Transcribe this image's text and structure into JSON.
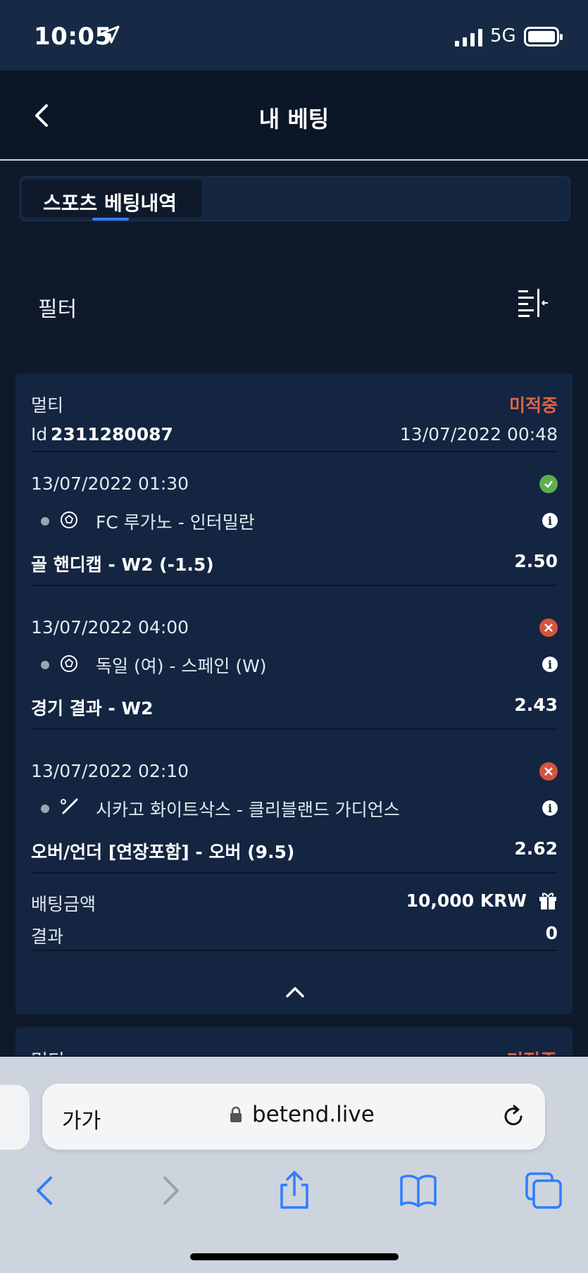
{
  "status_bar": {
    "time": "10:05",
    "network": "5G"
  },
  "header": {
    "title": "내 베팅"
  },
  "tabs": [
    {
      "label": "스포츠 베팅내역",
      "active": true
    }
  ],
  "filter": {
    "label": "필터"
  },
  "bet": {
    "type": "멀티",
    "status": "미적중",
    "id_label": "Id",
    "id_value": "2311280087",
    "placed_at": "13/07/2022 00:48",
    "selections": [
      {
        "datetime": "13/07/2022 01:30",
        "result": "won",
        "sport": "soccer",
        "event": "FC 루가노 - 인터밀란",
        "market": "골 핸디캡 - W2 (-1.5)",
        "odds": "2.50"
      },
      {
        "datetime": "13/07/2022 04:00",
        "result": "lost",
        "sport": "soccer",
        "event": "독일 (여) - 스페인 (W)",
        "market": "경기 결과 - W2",
        "odds": "2.43"
      },
      {
        "datetime": "13/07/2022 02:10",
        "result": "lost",
        "sport": "baseball",
        "event": "시카고 화이트삭스 - 클리블랜드 가디언스",
        "market": "오버/언더 [연장포함] - 오버 (9.5)",
        "odds": "2.62"
      }
    ],
    "stake_label": "배팅금액",
    "stake_value": "10,000 KRW",
    "result_label": "결과",
    "result_value": "0"
  },
  "next_bet": {
    "type": "멀티",
    "status": "미적중"
  },
  "browser": {
    "aa_label": "가가",
    "url": "betend.live"
  },
  "colors": {
    "background": "#0e1a2b",
    "card": "#132540",
    "lost": "#e0624a",
    "won": "#5fae4e",
    "accent": "#2f7dff"
  }
}
